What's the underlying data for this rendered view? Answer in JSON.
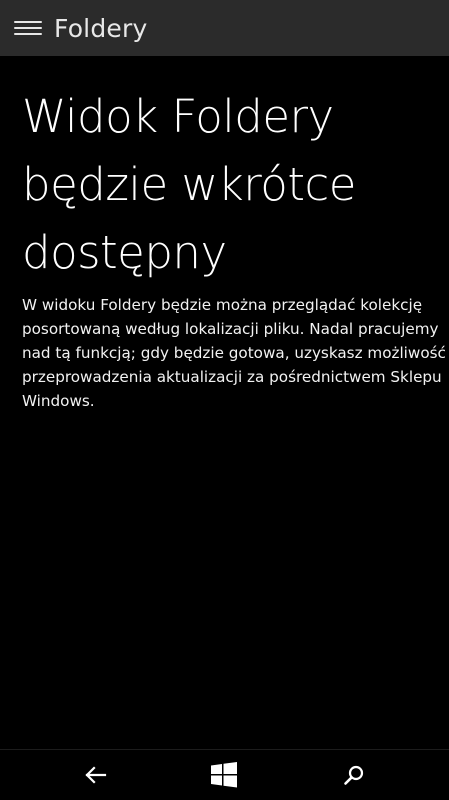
{
  "header": {
    "menu_icon": "hamburger-icon",
    "title": "Foldery"
  },
  "main": {
    "heading_lines": [
      "Widok Foldery",
      "będzie wkrótce",
      "dostępny"
    ],
    "description": "W widoku Foldery będzie można przeglądać kolekcję posortowaną według lokalizacji pliku. Nadal pracujemy nad tą funkcją; gdy będzie gotowa, uzyskasz możliwość przeprowadzenia aktualizacji za pośrednictwem Sklepu Windows."
  },
  "nav_bar": {
    "back_icon": "back-arrow-icon",
    "start_icon": "windows-logo-icon",
    "search_icon": "search-icon"
  }
}
